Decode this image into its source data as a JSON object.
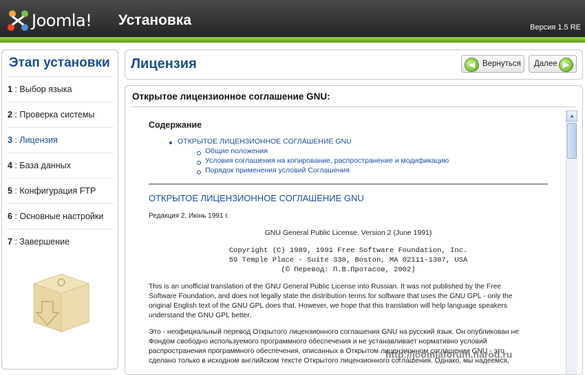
{
  "header": {
    "logo_text": "Joomla!",
    "app_title": "Установка",
    "version": "Версия 1.5 RE"
  },
  "sidebar": {
    "title": "Этап установки",
    "steps": [
      {
        "num": "1",
        "label": "Выбор языка",
        "active": false
      },
      {
        "num": "2",
        "label": "Проверка системы",
        "active": false
      },
      {
        "num": "3",
        "label": "Лицензия",
        "active": true
      },
      {
        "num": "4",
        "label": "База данных",
        "active": false
      },
      {
        "num": "5",
        "label": "Конфигурация FTP",
        "active": false
      },
      {
        "num": "6",
        "label": "Основные настройки",
        "active": false
      },
      {
        "num": "7",
        "label": "Завершение",
        "active": false
      }
    ]
  },
  "toolbar": {
    "page_title": "Лицензия",
    "back_label": "Вернуться",
    "next_label": "Далее"
  },
  "content": {
    "title": "Открытое лицензионное соглашение GNU:",
    "toc_heading": "Содержание",
    "toc": [
      {
        "level": 1,
        "label": "ОТКРЫТОЕ ЛИЦЕНЗИОННОЕ СОГЛАШЕНИЕ GNU"
      },
      {
        "level": 2,
        "label": "Общие положения"
      },
      {
        "level": 2,
        "label": "Условия соглашения на копирование, распространение и модификацию"
      },
      {
        "level": 2,
        "label": "Порядок применения условий Соглашения"
      }
    ],
    "section_heading": "ОТКРЫТОЕ ЛИЦЕНЗИОННОЕ СОГЛАШЕНИЕ GNU",
    "revision": "Редакция 2, Июнь 1991 г.",
    "gpl_title": "GNU General Public License. Version 2 (June 1991)",
    "copyright_1": "Copyright (C) 1989, 1991 Free Software Foundation, Inc.",
    "copyright_2": "59 Temple Place - Suite 330, Boston, MA  02111-1307, USA",
    "copyright_3": "(© Перевод: П.В.Протасов, 2002)",
    "para_en_lines": [
      "This is an unofficial translation of the GNU General Public License into Russian. It was not published by the Free",
      "Software Foundation, and does not legally state the distribution terms for software that uses the GNU GPL - only the",
      "original English text of the GNU GPL does that. However, we hope that this translation will help language speakers",
      "understand the GNU GPL better."
    ],
    "para_ru_lines": [
      "Это - неофициальный перевод Открытого лицензионного соглашения GNU на русский язык. Он опубликован не",
      "Фондом свободно используемого программного обеспечения и не устанавливает нормативно условий",
      "распространения программного обеспечения, описанных в Открытом лицензионном соглашении GNU - это",
      "сделано только в исходном английском тексте Открытого лицензионного соглашения. Однако, мы надеемся,"
    ]
  },
  "watermark": "http://joomlaforum.narod.ru",
  "colors": {
    "accent_blue": "#1d4e8f",
    "link_blue": "#1d4ea0",
    "header_green": "#7cc034"
  }
}
